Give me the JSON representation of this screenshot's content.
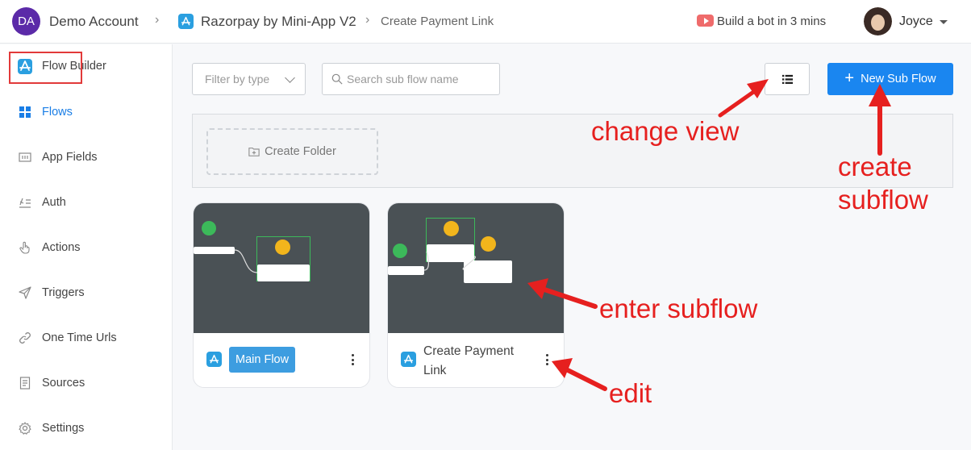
{
  "header": {
    "account_initials": "DA",
    "account_name": "Demo Account",
    "separator": "›",
    "app_name": "Razorpay by Mini-App V2",
    "page_name": "Create Payment Link",
    "build_bot_label": "Build a bot in 3 mins",
    "user_name": "Joyce"
  },
  "sidebar": {
    "items": [
      {
        "label": "Flow Builder",
        "icon": "app-store-icon"
      },
      {
        "label": "Flows",
        "icon": "grid-icon",
        "active": true
      },
      {
        "label": "App Fields",
        "icon": "fields-icon"
      },
      {
        "label": "Auth",
        "icon": "auth-icon"
      },
      {
        "label": "Actions",
        "icon": "hand-pointer-icon"
      },
      {
        "label": "Triggers",
        "icon": "send-icon"
      },
      {
        "label": "One Time Urls",
        "icon": "link-icon"
      },
      {
        "label": "Sources",
        "icon": "document-icon"
      },
      {
        "label": "Settings",
        "icon": "gear-icon"
      }
    ]
  },
  "toolbar": {
    "filter_placeholder": "Filter by type",
    "search_placeholder": "Search sub flow name",
    "new_button_label": "New Sub Flow"
  },
  "folders": {
    "create_label": "Create Folder"
  },
  "cards": [
    {
      "title": "Main Flow"
    },
    {
      "title": "Create Payment Link"
    }
  ],
  "annotations": {
    "change_view": "change view",
    "create_subflow_line1": "create",
    "create_subflow_line2": "subflow",
    "enter_subflow": "enter subflow",
    "edit": "edit"
  },
  "colors": {
    "accent": "#1a86f0",
    "annotation": "#e6201f",
    "highlight_box": "#e23a3a",
    "preview_bg": "#4a5155"
  }
}
